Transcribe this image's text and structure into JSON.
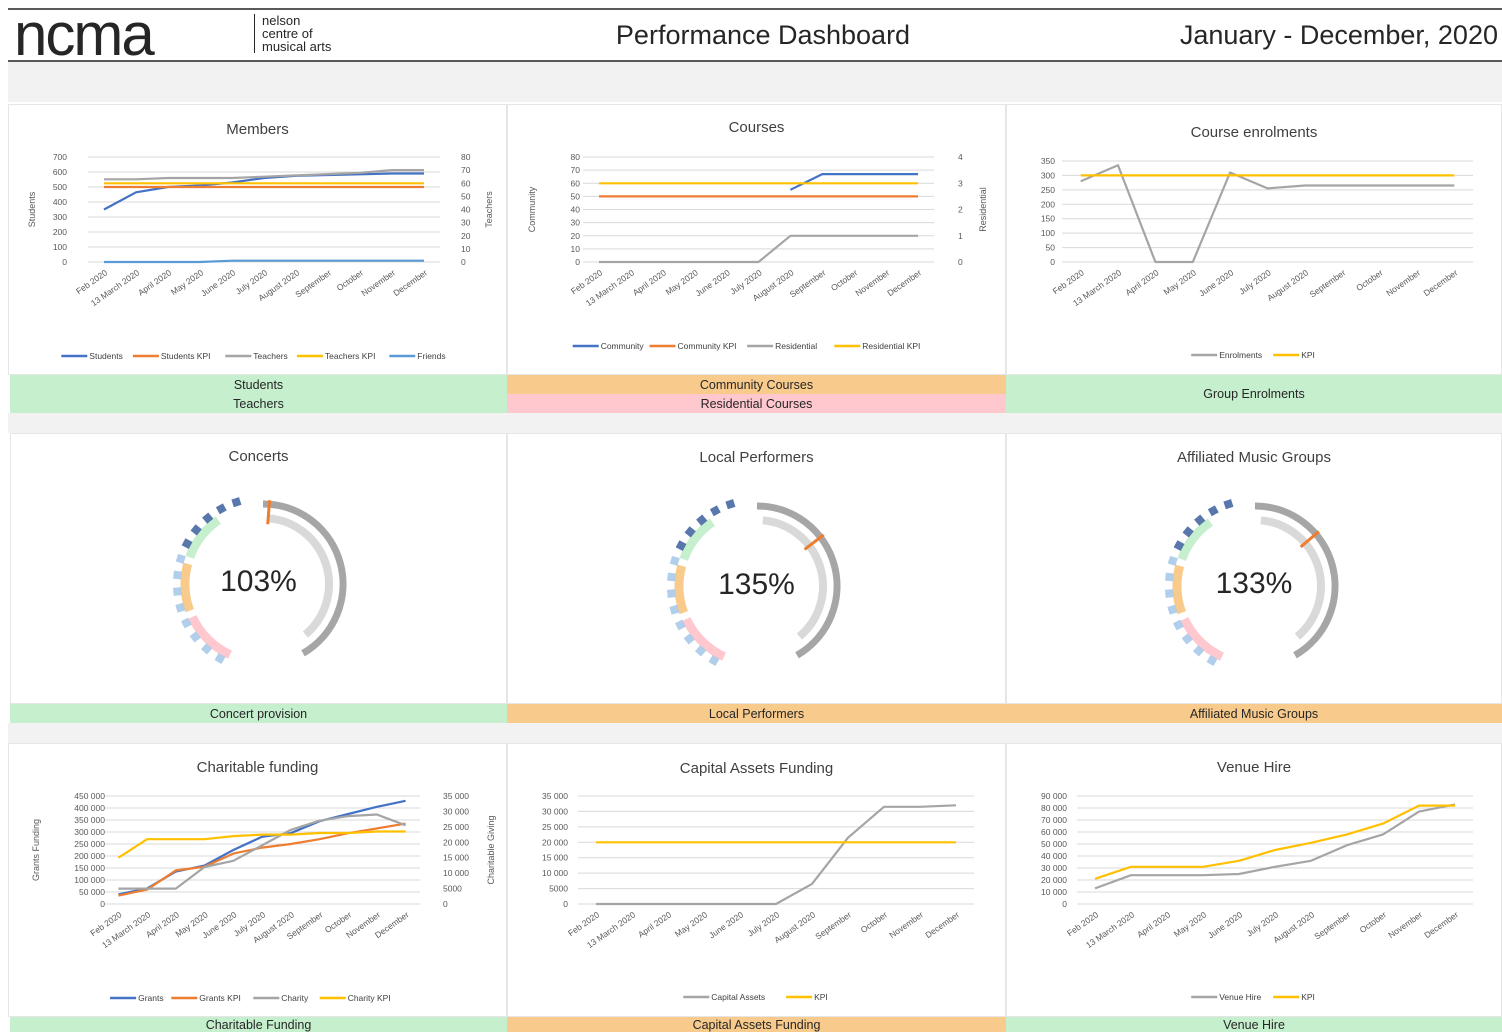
{
  "header": {
    "logo_word": "ncma",
    "logo_sub": [
      "nelson",
      "centre of",
      "musical arts"
    ],
    "title": "Performance Dashboard",
    "date_range": "January - December, 2020"
  },
  "months": [
    "Feb 2020",
    "13 March 2020",
    "April 2020",
    "May 2020",
    "June 2020",
    "July 2020",
    "August 2020",
    "September",
    "October",
    "November",
    "December"
  ],
  "colors": {
    "blue": "#4472c4",
    "orange": "#ed7d31",
    "gray": "#a5a5a5",
    "yellow": "#ffc000",
    "lightblue": "#5b9bd5",
    "green": "#c6efce",
    "amber": "#f8cb8c",
    "pink": "#ffc7ce"
  },
  "strips": {
    "members": [
      "Students",
      "Teachers"
    ],
    "courses": [
      "Community Courses",
      "Residential Courses"
    ],
    "enrolments": "Group Enrolments",
    "concerts": "Concert provision",
    "performers": "Local Performers",
    "affiliated": "Affiliated Music Groups",
    "charitable": "Charitable Funding",
    "capital": "Capital Assets Funding",
    "venue": "Venue Hire"
  },
  "gauges": {
    "concerts": {
      "title": "Concerts",
      "value": "103%",
      "fraction": 1.03
    },
    "performers": {
      "title": "Local Performers",
      "value": "135%",
      "fraction": 1.35
    },
    "affiliated": {
      "title": "Affiliated Music Groups",
      "value": "133%",
      "fraction": 1.33
    }
  },
  "chart_data": [
    {
      "id": "members",
      "type": "line",
      "title": "Members",
      "xlabel": "",
      "ylabel": "Students",
      "y2label": "Teachers",
      "ylim": [
        0,
        700
      ],
      "yticks": [
        0,
        100,
        200,
        300,
        400,
        500,
        600,
        700
      ],
      "y2lim": [
        0,
        80
      ],
      "y2ticks": [
        0,
        10,
        20,
        30,
        40,
        50,
        60,
        70,
        80
      ],
      "series": [
        {
          "name": "Students",
          "axis": "left",
          "color": "#4472c4",
          "values": [
            350,
            465,
            500,
            510,
            530,
            560,
            575,
            580,
            585,
            590,
            590
          ]
        },
        {
          "name": "Students KPI",
          "axis": "left",
          "color": "#ed7d31",
          "values": [
            500,
            500,
            500,
            500,
            500,
            500,
            500,
            500,
            500,
            500,
            500
          ]
        },
        {
          "name": "Teachers",
          "axis": "right",
          "color": "#a5a5a5",
          "values": [
            63,
            63,
            64,
            64,
            64,
            65,
            66,
            67,
            68,
            70,
            70
          ]
        },
        {
          "name": "Teachers KPI",
          "axis": "right",
          "color": "#ffc000",
          "values": [
            60,
            60,
            60,
            60,
            60,
            60,
            60,
            60,
            60,
            60,
            60
          ]
        },
        {
          "name": "Friends",
          "axis": "right",
          "color": "#5b9bd5",
          "values": [
            0,
            0,
            0,
            0,
            1,
            1,
            1,
            1,
            1,
            1,
            1
          ]
        }
      ]
    },
    {
      "id": "courses",
      "type": "line",
      "title": "Courses",
      "xlabel": "",
      "ylabel": "Community",
      "y2label": "Residential",
      "ylim": [
        0,
        80
      ],
      "yticks": [
        0,
        10,
        20,
        30,
        40,
        50,
        60,
        70,
        80
      ],
      "y2lim": [
        0,
        4
      ],
      "y2ticks": [
        0,
        1,
        2,
        3,
        4
      ],
      "series": [
        {
          "name": "Community",
          "axis": "left",
          "color": "#4472c4",
          "values": [
            null,
            null,
            null,
            null,
            null,
            null,
            55,
            67,
            67,
            67,
            67
          ]
        },
        {
          "name": "Community KPI",
          "axis": "left",
          "color": "#ed7d31",
          "values": [
            50,
            50,
            50,
            50,
            50,
            50,
            50,
            50,
            50,
            50,
            50
          ]
        },
        {
          "name": "Residential",
          "axis": "right",
          "color": "#a5a5a5",
          "values": [
            0,
            0,
            0,
            0,
            0,
            0,
            1,
            1,
            1,
            1,
            1
          ]
        },
        {
          "name": "Residential KPI",
          "axis": "left",
          "color": "#ffc000",
          "values": [
            60,
            60,
            60,
            60,
            60,
            60,
            60,
            60,
            60,
            60,
            60
          ]
        }
      ]
    },
    {
      "id": "enrolments",
      "type": "line",
      "title": "Course enrolments",
      "xlabel": "",
      "ylabel": "",
      "ylim": [
        0,
        350
      ],
      "yticks": [
        0,
        50,
        100,
        150,
        200,
        250,
        300,
        350
      ],
      "series": [
        {
          "name": "Enrolments",
          "axis": "left",
          "color": "#a5a5a5",
          "values": [
            280,
            335,
            0,
            0,
            310,
            255,
            265,
            265,
            265,
            265,
            265
          ]
        },
        {
          "name": "KPI",
          "axis": "left",
          "color": "#ffc000",
          "values": [
            300,
            300,
            300,
            300,
            300,
            300,
            300,
            300,
            300,
            300,
            300
          ]
        }
      ]
    },
    {
      "id": "charitable",
      "type": "line",
      "title": "Charitable funding",
      "xlabel": "",
      "ylabel": "Grants Funding",
      "y2label": "Charitable Giving",
      "ylim": [
        0,
        450000
      ],
      "yticks": [
        0,
        50000,
        100000,
        150000,
        200000,
        250000,
        300000,
        350000,
        400000,
        450000
      ],
      "y2lim": [
        0,
        35000
      ],
      "y2ticks": [
        0,
        5000,
        10000,
        15000,
        20000,
        25000,
        30000,
        35000
      ],
      "series": [
        {
          "name": "Grants",
          "axis": "left",
          "color": "#4472c4",
          "values": [
            40000,
            65000,
            135000,
            160000,
            225000,
            280000,
            295000,
            345000,
            375000,
            405000,
            430000
          ]
        },
        {
          "name": "Grants KPI",
          "axis": "left",
          "color": "#ed7d31",
          "values": [
            35000,
            60000,
            140000,
            155000,
            210000,
            235000,
            250000,
            270000,
            295000,
            315000,
            335000
          ]
        },
        {
          "name": "Charity",
          "axis": "right",
          "color": "#a5a5a5",
          "values": [
            5000,
            5000,
            5000,
            12000,
            14000,
            19000,
            24000,
            27000,
            28500,
            29000,
            25500
          ]
        },
        {
          "name": "Charity KPI",
          "axis": "right",
          "color": "#ffc000",
          "values": [
            15000,
            21000,
            21000,
            21000,
            22000,
            22500,
            22500,
            23000,
            23000,
            23500,
            23500
          ]
        }
      ]
    },
    {
      "id": "capital",
      "type": "line",
      "title": "Capital Assets Funding",
      "xlabel": "",
      "ylabel": "",
      "ylim": [
        0,
        35000
      ],
      "yticks": [
        0,
        5000,
        10000,
        15000,
        20000,
        25000,
        30000,
        35000
      ],
      "series": [
        {
          "name": "Capital Assets",
          "axis": "left",
          "color": "#a5a5a5",
          "values": [
            0,
            0,
            0,
            0,
            0,
            0,
            6500,
            21500,
            31500,
            31500,
            32000
          ]
        },
        {
          "name": "KPI",
          "axis": "left",
          "color": "#ffc000",
          "values": [
            20000,
            20000,
            20000,
            20000,
            20000,
            20000,
            20000,
            20000,
            20000,
            20000,
            20000
          ]
        }
      ]
    },
    {
      "id": "venue",
      "type": "line",
      "title": "Venue Hire",
      "xlabel": "",
      "ylabel": "",
      "ylim": [
        0,
        90000
      ],
      "yticks": [
        0,
        10000,
        20000,
        30000,
        40000,
        50000,
        60000,
        70000,
        80000,
        90000
      ],
      "series": [
        {
          "name": "Venue Hire",
          "axis": "left",
          "color": "#a5a5a5",
          "values": [
            13000,
            24000,
            24000,
            24000,
            25000,
            31000,
            36000,
            49000,
            58000,
            77000,
            83000
          ]
        },
        {
          "name": "KPI",
          "axis": "left",
          "color": "#ffc000",
          "values": [
            21000,
            31000,
            31000,
            31000,
            36000,
            45000,
            51000,
            58000,
            67000,
            82000,
            82000
          ]
        }
      ]
    }
  ]
}
